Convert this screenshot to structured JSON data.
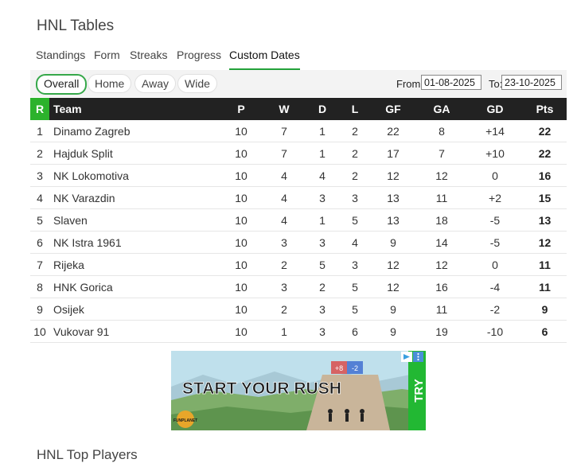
{
  "page": {
    "title": "HNL Tables",
    "section2_title": "HNL Top Players"
  },
  "tabs": [
    "Standings",
    "Form",
    "Streaks",
    "Progress",
    "Custom Dates"
  ],
  "active_tab": "Custom Dates",
  "filters": [
    "Overall",
    "Home",
    "Away",
    "Wide"
  ],
  "active_filter": "Overall",
  "date_range": {
    "from_label": "From:",
    "from_value": "01-08-2025",
    "to_label": "To:",
    "to_value": "23-10-2025"
  },
  "table": {
    "headers": [
      "R",
      "Team",
      "P",
      "W",
      "D",
      "L",
      "GF",
      "GA",
      "GD",
      "Pts"
    ],
    "rows": [
      [
        "1",
        "Dinamo Zagreb",
        "10",
        "7",
        "1",
        "2",
        "22",
        "8",
        "+14",
        "22"
      ],
      [
        "2",
        "Hajduk Split",
        "10",
        "7",
        "1",
        "2",
        "17",
        "7",
        "+10",
        "22"
      ],
      [
        "3",
        "NK Lokomotiva",
        "10",
        "4",
        "4",
        "2",
        "12",
        "12",
        "0",
        "16"
      ],
      [
        "4",
        "NK Varazdin",
        "10",
        "4",
        "3",
        "3",
        "13",
        "11",
        "+2",
        "15"
      ],
      [
        "5",
        "Slaven",
        "10",
        "4",
        "1",
        "5",
        "13",
        "18",
        "-5",
        "13"
      ],
      [
        "6",
        "NK Istra 1961",
        "10",
        "3",
        "3",
        "4",
        "9",
        "14",
        "-5",
        "12"
      ],
      [
        "7",
        "Rijeka",
        "10",
        "2",
        "5",
        "3",
        "12",
        "12",
        "0",
        "11"
      ],
      [
        "8",
        "HNK Gorica",
        "10",
        "3",
        "2",
        "5",
        "12",
        "16",
        "-4",
        "11"
      ],
      [
        "9",
        "Osijek",
        "10",
        "2",
        "3",
        "5",
        "9",
        "11",
        "-2",
        "9"
      ],
      [
        "10",
        "Vukovar 91",
        "10",
        "1",
        "3",
        "6",
        "9",
        "19",
        "-10",
        "6"
      ]
    ]
  },
  "ad": {
    "headline": "START YOUR RUSH",
    "cta": "TRY",
    "badge_left": "+8",
    "badge_right": "-2",
    "brand": "FUNPLANET"
  },
  "colors": {
    "accent": "#2cb22c",
    "header_bg": "#222222"
  }
}
